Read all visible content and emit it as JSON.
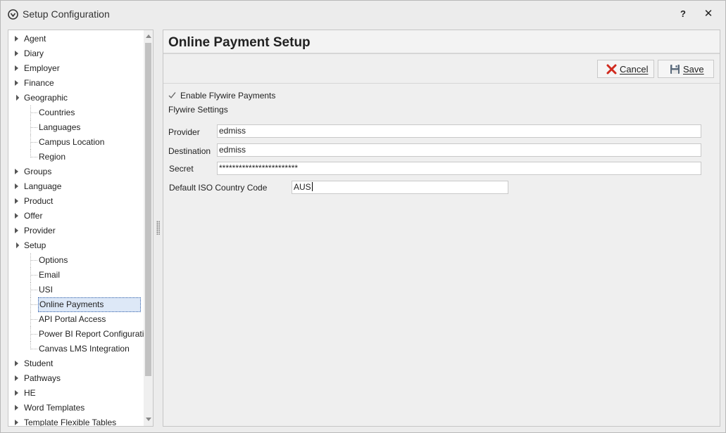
{
  "window": {
    "title": "Setup Configuration",
    "help_label": "?",
    "close_label": "✕"
  },
  "tree": {
    "items": [
      {
        "label": "Agent",
        "level": 0,
        "expanded": false
      },
      {
        "label": "Diary",
        "level": 0,
        "expanded": false
      },
      {
        "label": "Employer",
        "level": 0,
        "expanded": false
      },
      {
        "label": "Finance",
        "level": 0,
        "expanded": false
      },
      {
        "label": "Geographic",
        "level": 0,
        "expanded": true
      },
      {
        "label": "Countries",
        "level": 1
      },
      {
        "label": "Languages",
        "level": 1
      },
      {
        "label": "Campus Location",
        "level": 1
      },
      {
        "label": "Region",
        "level": 1,
        "last": true
      },
      {
        "label": "Groups",
        "level": 0,
        "expanded": false
      },
      {
        "label": "Language",
        "level": 0,
        "expanded": false
      },
      {
        "label": "Product",
        "level": 0,
        "expanded": false
      },
      {
        "label": "Offer",
        "level": 0,
        "expanded": false
      },
      {
        "label": "Provider",
        "level": 0,
        "expanded": false
      },
      {
        "label": "Setup",
        "level": 0,
        "expanded": true
      },
      {
        "label": "Options",
        "level": 1
      },
      {
        "label": "Email",
        "level": 1
      },
      {
        "label": "USI",
        "level": 1
      },
      {
        "label": "Online Payments",
        "level": 1,
        "selected": true
      },
      {
        "label": "API Portal Access",
        "level": 1
      },
      {
        "label": "Power BI Report Configuration",
        "level": 1
      },
      {
        "label": "Canvas LMS Integration",
        "level": 1,
        "last": true
      },
      {
        "label": "Student",
        "level": 0,
        "expanded": false
      },
      {
        "label": "Pathways",
        "level": 0,
        "expanded": false
      },
      {
        "label": "HE",
        "level": 0,
        "expanded": false
      },
      {
        "label": "Word Templates",
        "level": 0,
        "expanded": false
      },
      {
        "label": "Template Flexible Tables",
        "level": 0,
        "expanded": false
      }
    ]
  },
  "content": {
    "title": "Online Payment Setup",
    "toolbar": {
      "cancel_label": "Cancel",
      "save_label": "Save"
    },
    "enable_flywire": {
      "label": "Enable Flywire Payments",
      "checked": true
    },
    "section_label": "Flywire Settings",
    "fields": {
      "provider": {
        "label": "Provider",
        "value": "edmiss"
      },
      "destination": {
        "label": "Destination",
        "value": "edmiss"
      },
      "secret": {
        "label": "Secret",
        "value": "************************"
      },
      "country_code": {
        "label": "Default ISO Country Code",
        "value": "AUS"
      }
    }
  },
  "colors": {
    "cancel_icon": "#d02a1e",
    "selected_bg": "#dde8f7",
    "selected_border": "#2a5aa8"
  }
}
